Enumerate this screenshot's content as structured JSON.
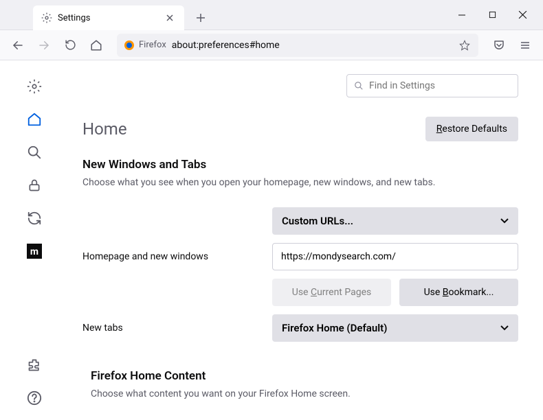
{
  "tab": {
    "title": "Settings"
  },
  "urlbar": {
    "brand": "Firefox",
    "url": "about:preferences#home"
  },
  "search": {
    "placeholder": "Find in Settings"
  },
  "page": {
    "title": "Home",
    "restore": "Restore Defaults",
    "section1_title": "New Windows and Tabs",
    "section1_sub": "Choose what you see when you open your homepage, new windows, and new tabs.",
    "row1_label": "Homepage and new windows",
    "row1_select": "Custom URLs...",
    "row1_value": "https://mondysearch.com/",
    "use_current": "Use Current Pages",
    "use_bookmark": "Use Bookmark...",
    "row2_label": "New tabs",
    "row2_select": "Firefox Home (Default)",
    "section2_title": "Firefox Home Content",
    "section2_sub": "Choose what content you want on your Firefox Home screen."
  }
}
